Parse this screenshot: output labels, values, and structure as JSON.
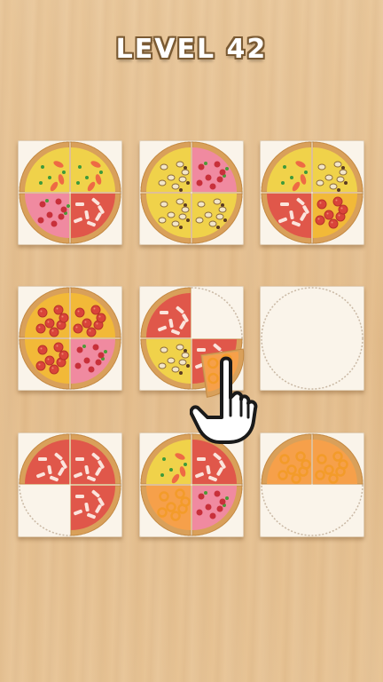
{
  "header": {
    "level_label": "LEVEL 42"
  },
  "colors": {
    "tile_bg": "#faf4ea",
    "crust": "#d9a05a",
    "margherita": "#f0d24a",
    "pepperoni_sauce": "#f2b938",
    "meat": "#e0574a",
    "ham": "#f08aa0",
    "onion": "#f6a04a",
    "empty_outline": "#c9b8a4"
  },
  "board": {
    "rows": 3,
    "cols": 3,
    "tiles": [
      {
        "slices": [
          "veggie",
          "veggie",
          "ham",
          "meat"
        ]
      },
      {
        "slices": [
          "mushroom",
          "ham",
          "mushroom",
          "mushroom"
        ]
      },
      {
        "slices": [
          "veggie",
          "mushroom",
          "meat",
          "pepperoni"
        ]
      },
      {
        "slices": [
          "pepperoni",
          "pepperoni",
          "pepperoni",
          "ham"
        ]
      },
      {
        "slices": [
          "meat",
          "empty",
          "mushroom",
          "meat"
        ]
      },
      {
        "slices": [
          "empty",
          "empty",
          "empty",
          "empty"
        ]
      },
      {
        "slices": [
          "meat",
          "meat",
          "empty",
          "meat"
        ]
      },
      {
        "slices": [
          "veggie",
          "meat",
          "onion",
          "ham"
        ]
      },
      {
        "slices": [
          "onion",
          "onion",
          "empty",
          "empty"
        ]
      }
    ]
  },
  "dragging_slice": {
    "type": "onion"
  },
  "tutorial": {
    "hand_icon": "pointing-hand-icon"
  }
}
